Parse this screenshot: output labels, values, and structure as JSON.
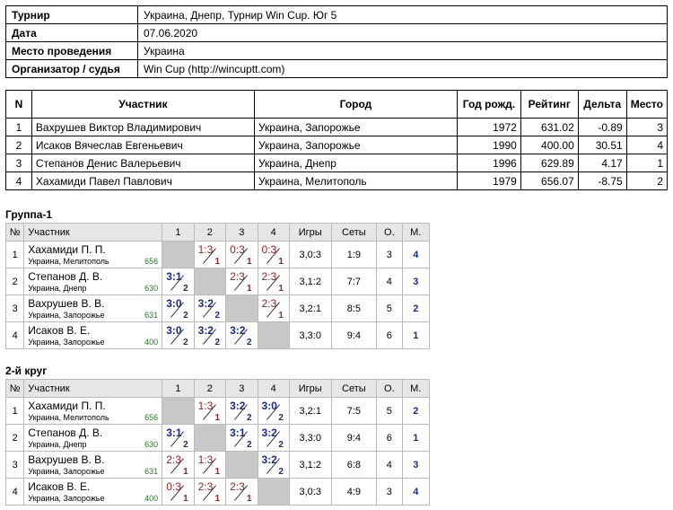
{
  "info": [
    {
      "key": "Турнир",
      "value": "Украина, Днепр, Турнир Win Cup. Юг 5"
    },
    {
      "key": "Дата",
      "value": "07.06.2020"
    },
    {
      "key": "Место проведения",
      "value": "Украина"
    },
    {
      "key": "Организатор / судья",
      "value": "Win Cup (http://wincuptt.com)"
    }
  ],
  "participants": {
    "headers": [
      "N",
      "Участник",
      "Город",
      "Год рожд.",
      "Рейтинг",
      "Дельта",
      "Место"
    ],
    "rows": [
      [
        "1",
        "Вахрушев Виктор Владимирович",
        "Украина, Запорожье",
        "1972",
        "631.02",
        "-0.89",
        "3"
      ],
      [
        "2",
        "Исаков Вячеслав Евгеньевич",
        "Украина, Запорожье",
        "1990",
        "400.00",
        "30.51",
        "4"
      ],
      [
        "3",
        "Степанов Денис Валерьевич",
        "Украина, Днепр",
        "1996",
        "629.89",
        "4.17",
        "1"
      ],
      [
        "4",
        "Хахамиди Павел Павлович",
        "Украина, Мелитополь",
        "1979",
        "656.07",
        "-8.75",
        "2"
      ]
    ]
  },
  "grid_headers": [
    "№",
    "Участник",
    "1",
    "2",
    "3",
    "4",
    "Игры",
    "Сеты",
    "О.",
    "М."
  ],
  "groups": [
    {
      "title": "Группа-1",
      "rows": [
        {
          "n": "1",
          "name": "Хахамиди П. П.",
          "city": "Украина, Мелитополь",
          "rating": "656",
          "scores": [
            null,
            [
              "1:3",
              "1",
              "loss"
            ],
            [
              "0:3",
              "1",
              "loss"
            ],
            [
              "0:3",
              "1",
              "loss"
            ]
          ],
          "games": "3,0:3",
          "sets": "1:9",
          "points": "3",
          "place": "4"
        },
        {
          "n": "2",
          "name": "Степанов Д. В.",
          "city": "Украина, Днепр",
          "rating": "630",
          "scores": [
            [
              "3:1",
              "2",
              "win"
            ],
            null,
            [
              "2:3",
              "1",
              "loss"
            ],
            [
              "2:3",
              "1",
              "loss"
            ]
          ],
          "games": "3,1:2",
          "sets": "7:7",
          "points": "4",
          "place": "3"
        },
        {
          "n": "3",
          "name": "Вахрушев В. В.",
          "city": "Украина, Запорожье",
          "rating": "631",
          "scores": [
            [
              "3:0",
              "2",
              "win"
            ],
            [
              "3:2",
              "2",
              "win"
            ],
            null,
            [
              "2:3",
              "1",
              "loss"
            ]
          ],
          "games": "3,2:1",
          "sets": "8:5",
          "points": "5",
          "place": "2"
        },
        {
          "n": "4",
          "name": "Исаков В. Е.",
          "city": "Украина, Запорожье",
          "rating": "400",
          "scores": [
            [
              "3:0",
              "2",
              "win"
            ],
            [
              "3:2",
              "2",
              "win"
            ],
            [
              "3:2",
              "2",
              "win"
            ],
            null
          ],
          "games": "3,3:0",
          "sets": "9:4",
          "points": "6",
          "place": "1"
        }
      ]
    },
    {
      "title": "2-й круг",
      "rows": [
        {
          "n": "1",
          "name": "Хахамиди П. П.",
          "city": "Украина, Мелитополь",
          "rating": "656",
          "scores": [
            null,
            [
              "1:3",
              "1",
              "loss"
            ],
            [
              "3:2",
              "2",
              "win"
            ],
            [
              "3:0",
              "2",
              "win"
            ]
          ],
          "games": "3,2:1",
          "sets": "7:5",
          "points": "5",
          "place": "2"
        },
        {
          "n": "2",
          "name": "Степанов Д. В.",
          "city": "Украина, Днепр",
          "rating": "630",
          "scores": [
            [
              "3:1",
              "2",
              "win"
            ],
            null,
            [
              "3:1",
              "2",
              "win"
            ],
            [
              "3:2",
              "2",
              "win"
            ]
          ],
          "games": "3,3:0",
          "sets": "9:4",
          "points": "6",
          "place": "1"
        },
        {
          "n": "3",
          "name": "Вахрушев В. В.",
          "city": "Украина, Запорожье",
          "rating": "631",
          "scores": [
            [
              "2:3",
              "1",
              "loss"
            ],
            [
              "1:3",
              "1",
              "loss"
            ],
            null,
            [
              "3:2",
              "2",
              "win"
            ]
          ],
          "games": "3,1:2",
          "sets": "6:8",
          "points": "4",
          "place": "3"
        },
        {
          "n": "4",
          "name": "Исаков В. Е.",
          "city": "Украина, Запорожье",
          "rating": "400",
          "scores": [
            [
              "0:3",
              "1",
              "loss"
            ],
            [
              "2:3",
              "1",
              "loss"
            ],
            [
              "2:3",
              "1",
              "loss"
            ],
            null
          ],
          "games": "3,0:3",
          "sets": "4:9",
          "points": "3",
          "place": "4"
        }
      ]
    }
  ]
}
